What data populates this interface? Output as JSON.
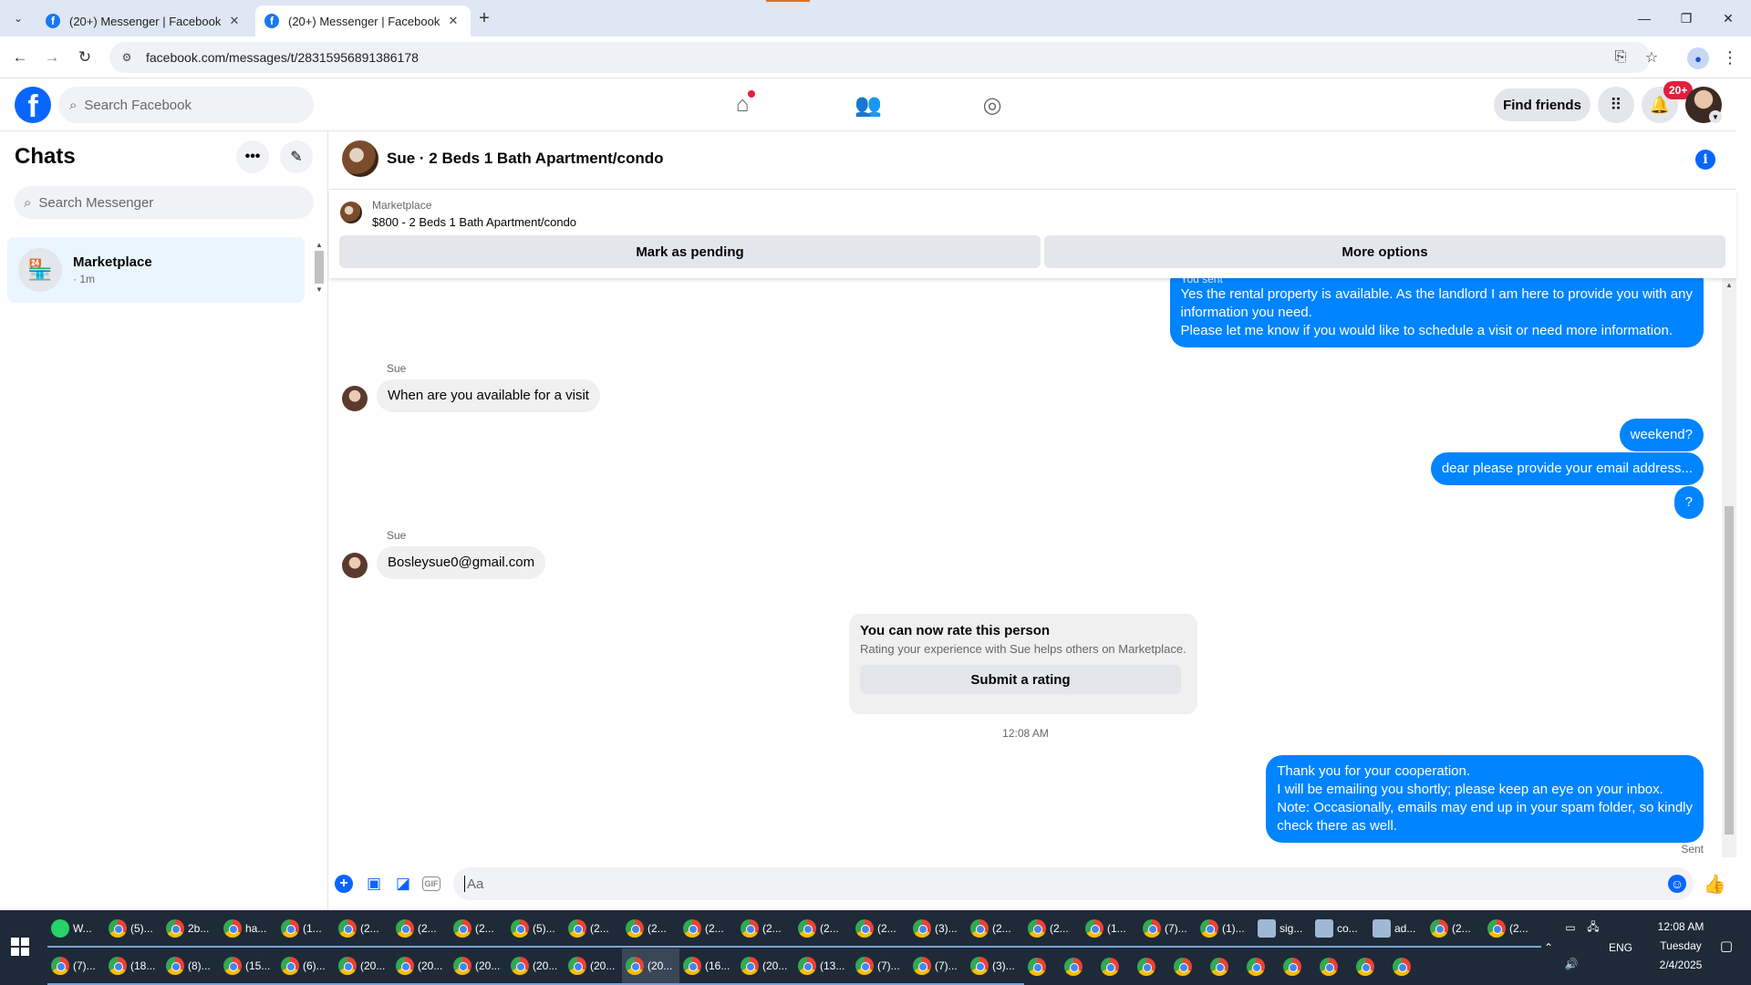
{
  "browser": {
    "tabs": [
      {
        "label": "(20+) Messenger | Facebook",
        "active": false
      },
      {
        "label": "(20+) Messenger | Facebook",
        "active": true
      }
    ],
    "url": "facebook.com/messages/t/28315956891386178"
  },
  "fb": {
    "search_placeholder": "Search Facebook",
    "find_friends": "Find friends",
    "notif_count": "20+"
  },
  "chats": {
    "title": "Chats",
    "search_placeholder": "Search Messenger",
    "items": [
      {
        "name": "Marketplace",
        "time": "· 1m"
      }
    ]
  },
  "conversation": {
    "title": "Sue · 2 Beds 1 Bath Apartment/condo",
    "listing": {
      "source": "Marketplace",
      "description": "$800 - 2 Beds 1 Bath Apartment/condo",
      "mark_pending": "Mark as pending",
      "more_options": "More options"
    },
    "messages": {
      "you_sent_label": "You sent",
      "m1_line1": "Yes the rental property is available. As the landlord I am here to provide you with any",
      "m1_line2": "information you need.",
      "m1_line3": "Please let me know if you would like to schedule a visit or need more information.",
      "sue1_sender": "Sue",
      "sue1_text": "When are you available for a visit",
      "m2": "weekend?",
      "m3": "dear please provide your email address...",
      "m4": "?",
      "sue2_sender": "Sue",
      "sue2_text": "Bosleysue0@gmail.com",
      "m5_line1": "Thank you for your cooperation.",
      "m5_line2": "I will be emailing you shortly; please keep an eye on your inbox.",
      "m5_line3": "Note: Occasionally, emails may end up in your spam folder, so kindly",
      "m5_line4": "check there as well."
    },
    "rate_card": {
      "title": "You can now rate this person",
      "subtitle": "Rating your experience with Sue helps others on Marketplace.",
      "button": "Submit a rating"
    },
    "timestamp": "12:08 AM",
    "status": "Sent",
    "composer_placeholder": "Aa"
  },
  "taskbar": {
    "row1": [
      "W...",
      "(5)...",
      "2b...",
      "ha...",
      "(1...",
      "(2...",
      "(2...",
      "(2...",
      "(5)...",
      "(2...",
      "(2...",
      "(2...",
      "(2...",
      "(2...",
      "(2...",
      "(3)...",
      "(2...",
      "(2...",
      "(1...",
      "(7)...",
      "(1)...",
      "sig...",
      "co...",
      "ad...",
      "(2...",
      "(2..."
    ],
    "row2": [
      "(7)...",
      "(18...",
      "(8)...",
      "(15...",
      "(6)...",
      "(20...",
      "(20...",
      "(20...",
      "(20...",
      "(20...",
      "(20...",
      "(16...",
      "(20...",
      "(13...",
      "(7)...",
      "(7)...",
      "(3)...",
      "",
      "",
      "",
      "",
      "",
      "",
      "",
      "",
      "",
      "",
      ""
    ],
    "lang": "ENG",
    "time": "12:08 AM",
    "day": "Tuesday",
    "date": "2/4/2025"
  }
}
